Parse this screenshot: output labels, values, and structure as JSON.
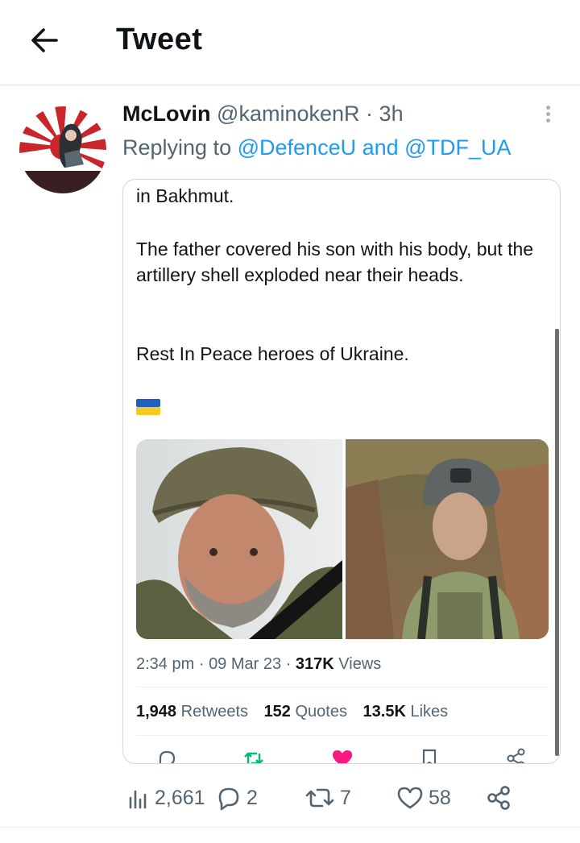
{
  "header": {
    "back_icon": "arrow-left-icon",
    "title": "Tweet"
  },
  "tweet": {
    "display_name": "McLovin",
    "handle": "@kaminokenR",
    "separator": "·",
    "time": "3h",
    "replying_prefix": "Replying to",
    "replying_to": "@DefenceU and @TDF_UA",
    "avatar_icon": "rising-sun-flag-avatar",
    "more_icon": "more-vertical-icon"
  },
  "quoted_screenshot": {
    "text_lines": [
      "in Bakhmut.",
      "The father covered his son with his body, but the artillery shell exploded near their heads.",
      "Rest In Peace heroes of Ukraine."
    ],
    "flag_icon": "ukraine-flag-emoji",
    "images": [
      "older-soldier-portrait",
      "younger-soldier-in-trench"
    ],
    "meta": {
      "time": "2:34 pm",
      "date": "09 Mar 23",
      "views_count": "317K",
      "views_label": "Views",
      "dot": "·"
    },
    "stats": {
      "retweets_count": "1,948",
      "retweets_label": "Retweets",
      "quotes_count": "152",
      "quotes_label": "Quotes",
      "likes_count": "13.5K",
      "likes_label": "Likes"
    }
  },
  "actions": {
    "views": "2,661",
    "replies": "2",
    "retweets": "7",
    "likes": "58"
  },
  "colors": {
    "accent": "#1d9bf0",
    "secondary_text": "#536471",
    "like_pink": "#f91880",
    "retweet_green": "#00ba7c"
  }
}
